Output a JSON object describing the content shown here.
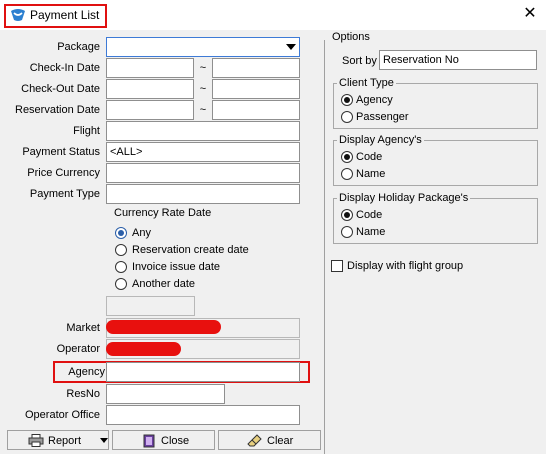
{
  "window": {
    "title": "Payment List",
    "close_glyph": "✕"
  },
  "form": {
    "package": {
      "label": "Package",
      "value": ""
    },
    "checkin": {
      "label": "Check-In Date",
      "from": "",
      "to": ""
    },
    "checkout": {
      "label": "Check-Out Date",
      "from": "",
      "to": ""
    },
    "reservation": {
      "label": "Reservation Date",
      "from": "",
      "to": ""
    },
    "range_sep": "~",
    "flight": {
      "label": "Flight",
      "value": ""
    },
    "payment_status": {
      "label": "Payment Status",
      "value": "<ALL>"
    },
    "price_currency": {
      "label": "Price Currency",
      "value": ""
    },
    "payment_type": {
      "label": "Payment Type",
      "value": ""
    },
    "currency_rate": {
      "heading": "Currency Rate Date",
      "options": [
        "Any",
        "Reservation create date",
        "Invoice issue date",
        "Another date"
      ],
      "selected": "Any",
      "another_date_value": ""
    },
    "market": {
      "label": "Market",
      "value_redacted": true
    },
    "operator": {
      "label": "Operator",
      "value_redacted": true
    },
    "agency": {
      "label": "Agency",
      "value": ""
    },
    "resno": {
      "label": "ResNo",
      "value": ""
    },
    "operator_office": {
      "label": "Operator Office",
      "value": ""
    }
  },
  "buttons": {
    "report": "Report",
    "close": "Close",
    "clear": "Clear"
  },
  "options": {
    "heading": "Options",
    "sort_by": {
      "label": "Sort by",
      "value": "Reservation No"
    },
    "client_type": {
      "title": "Client Type",
      "options": [
        "Agency",
        "Passenger"
      ],
      "selected": "Agency"
    },
    "display_agency": {
      "title": "Display Agency's",
      "options": [
        "Code",
        "Name"
      ],
      "selected": "Code"
    },
    "display_holiday": {
      "title": "Display Holiday Package's",
      "options": [
        "Code",
        "Name"
      ],
      "selected": "Code"
    },
    "flight_group": {
      "label": "Display with flight group",
      "checked": false
    }
  },
  "colors": {
    "highlight": "#e01010",
    "redaction": "#e8100e"
  },
  "icons": {
    "app": "app-logo-icon",
    "report": "printer-icon",
    "close": "door-exit-icon",
    "clear": "eraser-broom-icon",
    "dropdown": "chevron-down-icon"
  }
}
